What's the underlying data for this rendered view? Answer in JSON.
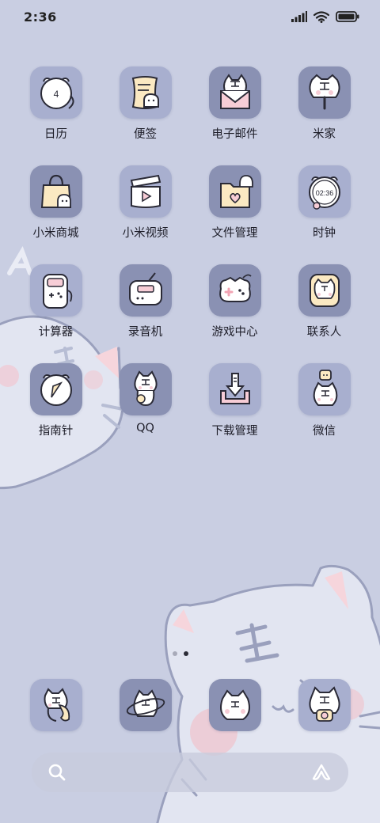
{
  "status_bar": {
    "time": "2:36",
    "signal_icon": "signal-icon",
    "wifi_icon": "wifi-icon",
    "battery_icon": "battery-icon"
  },
  "apps": [
    {
      "label": "日历",
      "icon": "calendar-icon",
      "badge": "4"
    },
    {
      "label": "便签",
      "icon": "notes-icon"
    },
    {
      "label": "电子邮件",
      "icon": "email-icon"
    },
    {
      "label": "米家",
      "icon": "mijia-icon"
    },
    {
      "label": "小米商城",
      "icon": "shopping-bag-icon"
    },
    {
      "label": "小米视频",
      "icon": "video-icon"
    },
    {
      "label": "文件管理",
      "icon": "folder-icon"
    },
    {
      "label": "时钟",
      "icon": "clock-icon",
      "badge": "02:36"
    },
    {
      "label": "计算器",
      "icon": "calculator-icon"
    },
    {
      "label": "录音机",
      "icon": "recorder-icon"
    },
    {
      "label": "游戏中心",
      "icon": "gamepad-icon"
    },
    {
      "label": "联系人",
      "icon": "contacts-icon"
    },
    {
      "label": "指南针",
      "icon": "compass-icon"
    },
    {
      "label": "QQ",
      "icon": "qq-icon"
    },
    {
      "label": "下载管理",
      "icon": "download-icon"
    },
    {
      "label": "微信",
      "icon": "wechat-icon"
    }
  ],
  "dock": [
    {
      "icon": "phone-icon"
    },
    {
      "icon": "browser-icon"
    },
    {
      "icon": "messages-icon"
    },
    {
      "icon": "camera-icon"
    }
  ],
  "search": {
    "placeholder": "",
    "search_icon": "search-icon",
    "assistant_icon": "assistant-icon"
  },
  "pages": {
    "count": 2,
    "active": 1
  },
  "colors": {
    "background": "#c9cee2",
    "icon_light": "#a9b0cf",
    "icon_dark": "#8a91b3",
    "cream": "#fbe9c2",
    "pink": "#f7cdd6"
  }
}
